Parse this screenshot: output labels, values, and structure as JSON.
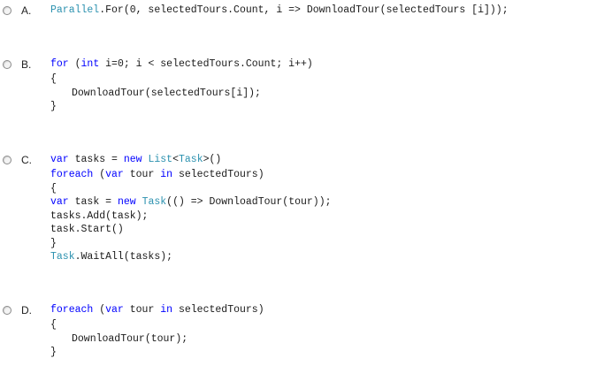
{
  "colors": {
    "keyword": "#0000ff",
    "type": "#2b91af",
    "text": "#1a1a1a"
  },
  "options": [
    {
      "letter": "A.",
      "lines": [
        {
          "indent": 0,
          "tokens": [
            {
              "text": "Parallel",
              "kind": "ty"
            },
            {
              "text": ".For(0, selectedTours.Count, i => DownloadTour(selectedTours [i]));",
              "kind": "tx"
            }
          ]
        }
      ]
    },
    {
      "letter": "B.",
      "lines": [
        {
          "indent": 0,
          "tokens": [
            {
              "text": "for",
              "kind": "kw"
            },
            {
              "text": " (",
              "kind": "tx"
            },
            {
              "text": "int",
              "kind": "kw"
            },
            {
              "text": " i=0; i < selectedTours.Count; i++)",
              "kind": "tx"
            }
          ]
        },
        {
          "indent": 0,
          "tokens": [
            {
              "text": "{",
              "kind": "tx"
            }
          ]
        },
        {
          "indent": 1,
          "tokens": [
            {
              "text": "DownloadTour(selectedTours[i]);",
              "kind": "tx"
            }
          ]
        },
        {
          "indent": 0,
          "tokens": [
            {
              "text": "}",
              "kind": "tx"
            }
          ]
        }
      ]
    },
    {
      "letter": "C.",
      "lines": [
        {
          "indent": 0,
          "tokens": [
            {
              "text": "var",
              "kind": "kw"
            },
            {
              "text": " tasks = ",
              "kind": "tx"
            },
            {
              "text": "new",
              "kind": "kw"
            },
            {
              "text": " ",
              "kind": "tx"
            },
            {
              "text": "List",
              "kind": "ty"
            },
            {
              "text": "<",
              "kind": "tx"
            },
            {
              "text": "Task",
              "kind": "ty"
            },
            {
              "text": ">()",
              "kind": "tx"
            }
          ]
        },
        {
          "indent": 0,
          "tokens": [
            {
              "text": "foreach",
              "kind": "kw"
            },
            {
              "text": " (",
              "kind": "tx"
            },
            {
              "text": "var",
              "kind": "kw"
            },
            {
              "text": " tour ",
              "kind": "tx"
            },
            {
              "text": "in",
              "kind": "kw"
            },
            {
              "text": " selectedTours)",
              "kind": "tx"
            }
          ]
        },
        {
          "indent": 0,
          "tokens": [
            {
              "text": "{",
              "kind": "tx"
            }
          ]
        },
        {
          "indent": 0,
          "tokens": [
            {
              "text": "var",
              "kind": "kw"
            },
            {
              "text": " task = ",
              "kind": "tx"
            },
            {
              "text": "new",
              "kind": "kw"
            },
            {
              "text": " ",
              "kind": "tx"
            },
            {
              "text": "Task",
              "kind": "ty"
            },
            {
              "text": "(() => DownloadTour(tour));",
              "kind": "tx"
            }
          ]
        },
        {
          "indent": 0,
          "tokens": [
            {
              "text": "tasks.Add(task);",
              "kind": "tx"
            }
          ]
        },
        {
          "indent": 0,
          "tokens": [
            {
              "text": "task.Start()",
              "kind": "tx"
            }
          ]
        },
        {
          "indent": 0,
          "tokens": [
            {
              "text": "}",
              "kind": "tx"
            }
          ]
        },
        {
          "indent": 0,
          "tokens": [
            {
              "text": "Task",
              "kind": "ty"
            },
            {
              "text": ".WaitAll(tasks);",
              "kind": "tx"
            }
          ]
        }
      ]
    },
    {
      "letter": "D.",
      "lines": [
        {
          "indent": 0,
          "tokens": [
            {
              "text": "foreach",
              "kind": "kw"
            },
            {
              "text": " (",
              "kind": "tx"
            },
            {
              "text": "var",
              "kind": "kw"
            },
            {
              "text": " tour ",
              "kind": "tx"
            },
            {
              "text": "in",
              "kind": "kw"
            },
            {
              "text": " selectedTours)",
              "kind": "tx"
            }
          ]
        },
        {
          "indent": 0,
          "tokens": [
            {
              "text": "{",
              "kind": "tx"
            }
          ]
        },
        {
          "indent": 1,
          "tokens": [
            {
              "text": "DownloadTour(tour);",
              "kind": "tx"
            }
          ]
        },
        {
          "indent": 0,
          "tokens": [
            {
              "text": "}",
              "kind": "tx"
            }
          ]
        }
      ]
    }
  ]
}
